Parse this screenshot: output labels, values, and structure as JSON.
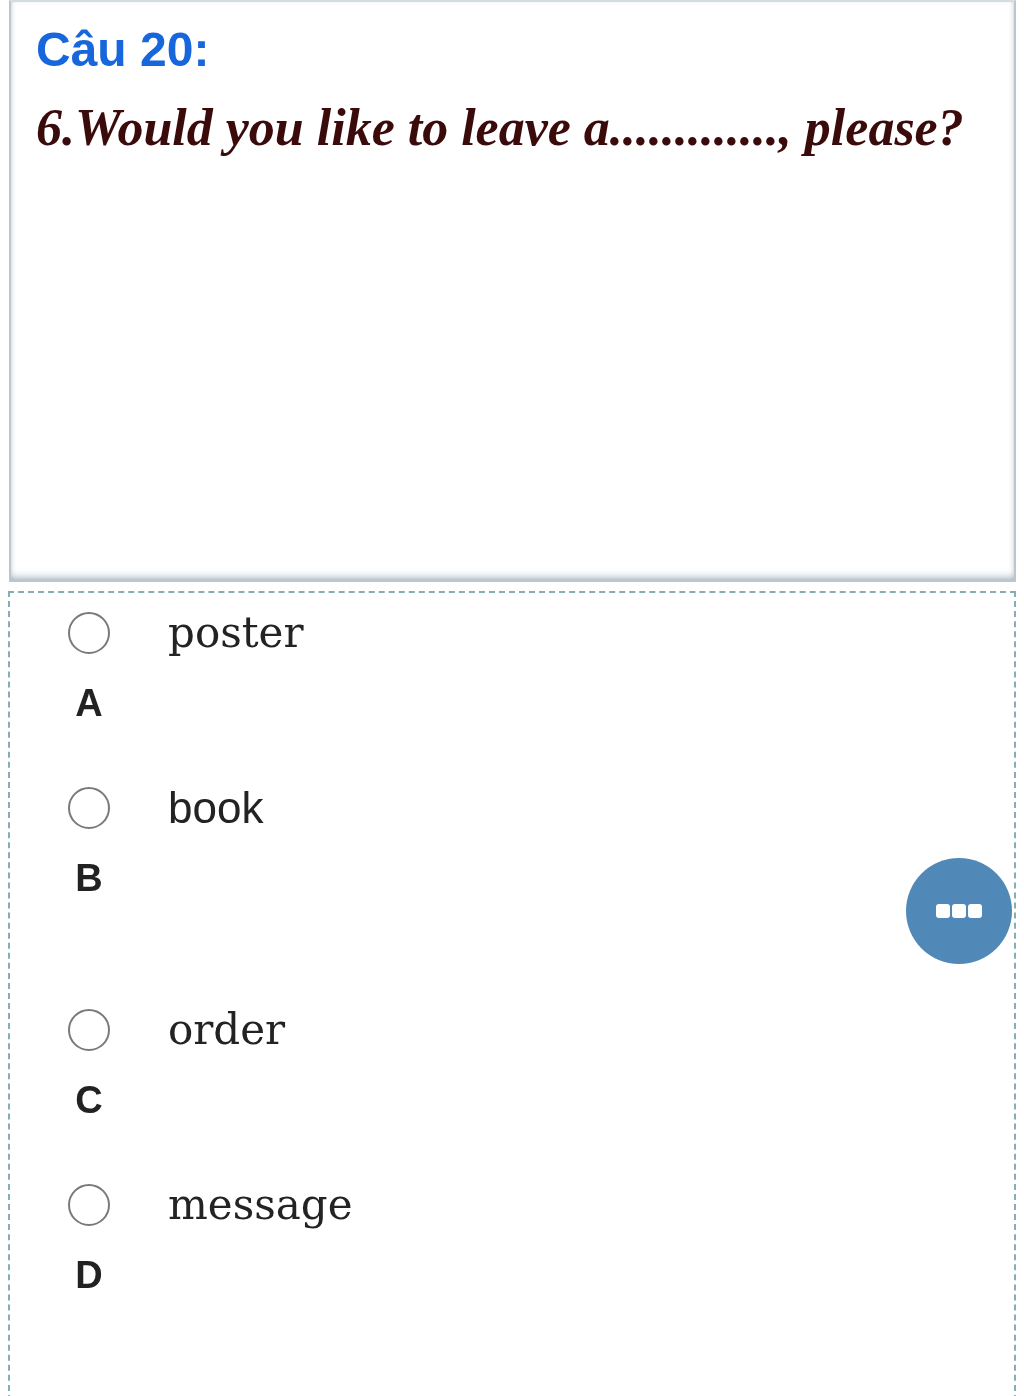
{
  "question": {
    "title": "Câu 20:",
    "text": "6.Would you like to leave a............., please?"
  },
  "options": [
    {
      "letter": "A",
      "text": "poster",
      "kind": "serif",
      "selected": false
    },
    {
      "letter": "B",
      "text": "book",
      "kind": "sans",
      "selected": false
    },
    {
      "letter": "C",
      "text": "order",
      "kind": "serif",
      "selected": false
    },
    {
      "letter": "D",
      "text": "message",
      "kind": "serif",
      "selected": false
    }
  ]
}
